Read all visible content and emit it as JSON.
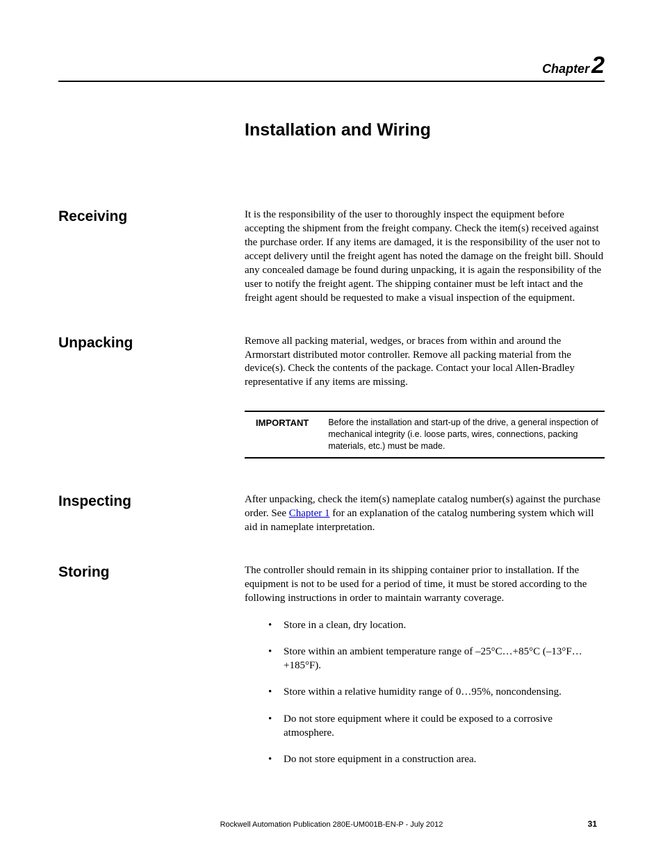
{
  "chapter": {
    "label": "Chapter",
    "number": "2"
  },
  "title": "Installation and Wiring",
  "sections": {
    "receiving": {
      "heading": "Receiving",
      "body": "It is the responsibility of the user to thoroughly inspect the equipment before accepting the shipment from the freight company. Check the item(s) received against the purchase order. If any items are damaged, it is the responsibility of the user not to accept delivery until the freight agent has noted the damage on the freight bill. Should any concealed damage be found during unpacking, it is again the responsibility of the user to notify the freight agent. The shipping container must be left intact and the freight agent should be requested to make a visual inspection of the equipment."
    },
    "unpacking": {
      "heading": "Unpacking",
      "body": "Remove all packing material, wedges, or braces from within and around the Armorstart distributed motor controller. Remove all packing material from the device(s). Check the contents of the package. Contact your local Allen-Bradley representative if any items are missing."
    },
    "important": {
      "label": "IMPORTANT",
      "text": "Before the installation and start-up of the drive, a general inspection of mechanical integrity (i.e. loose parts, wires, connections, packing materials, etc.) must be made."
    },
    "inspecting": {
      "heading": "Inspecting",
      "body_pre": "After unpacking, check the item(s) nameplate catalog number(s) against the purchase order. See ",
      "link": "Chapter 1",
      "body_post": " for an explanation of the catalog numbering system which will aid in nameplate interpretation."
    },
    "storing": {
      "heading": "Storing",
      "body": "The controller should remain in its shipping container prior to installation. If the equipment is not to be used for a period of time, it must be stored according to the following instructions in order to maintain warranty coverage.",
      "bullets": [
        "Store in a clean, dry location.",
        "Store within an ambient temperature range of –25°C…+85°C (–13°F…+185°F).",
        "Store within a relative humidity range of 0…95%, noncondensing.",
        "Do not store equipment where it could be exposed to a corrosive atmosphere.",
        "Do not store equipment in a construction area."
      ]
    }
  },
  "footer": {
    "publication": "Rockwell Automation Publication 280E-UM001B-EN-P - July 2012",
    "page": "31"
  }
}
